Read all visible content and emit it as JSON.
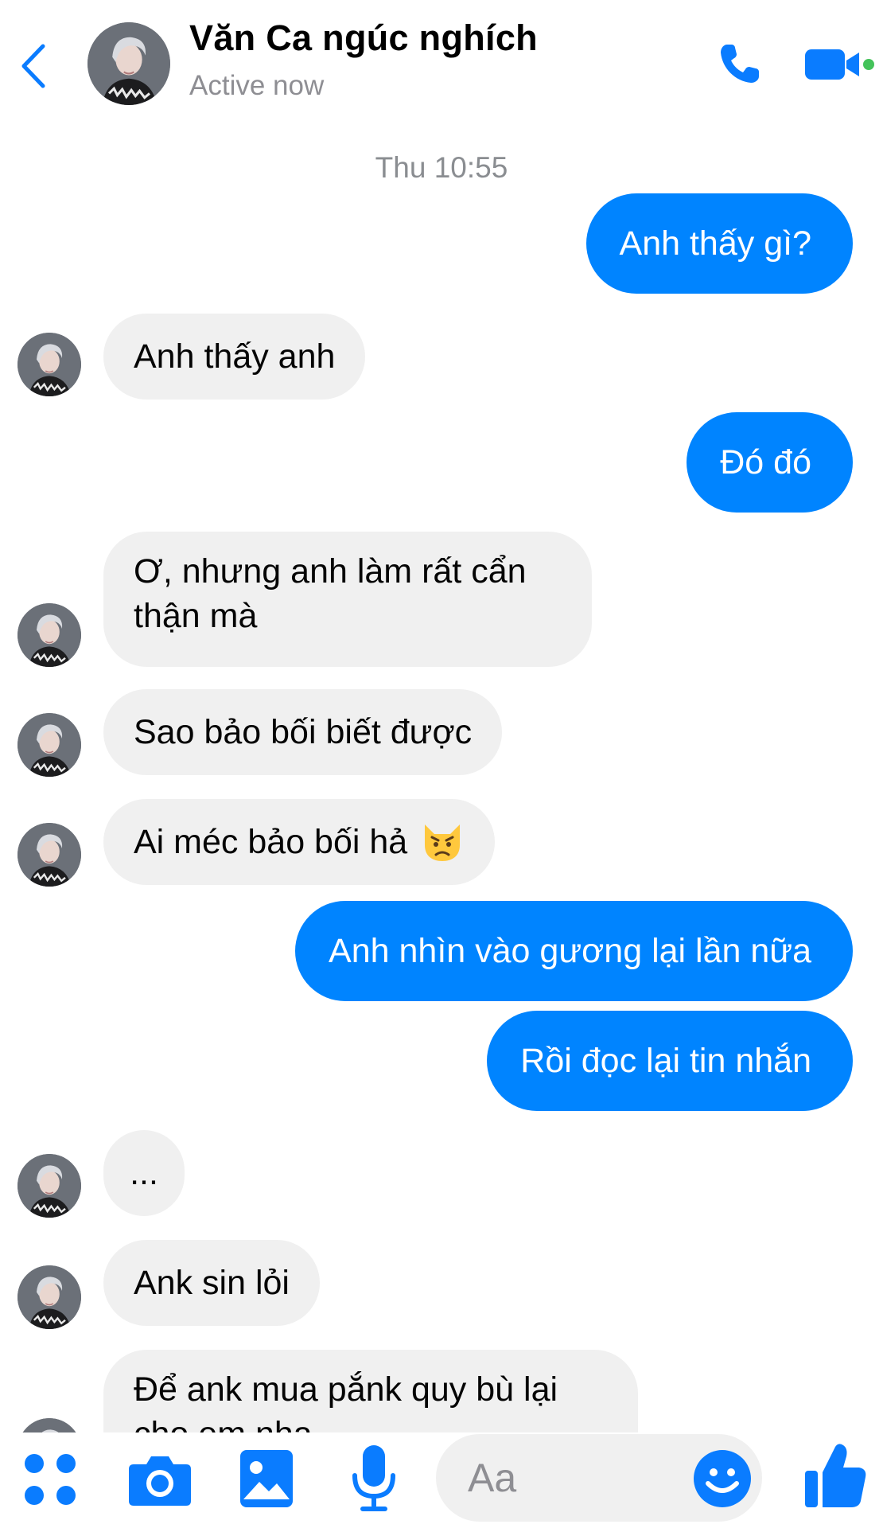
{
  "header": {
    "contact_name": "Văn Ca ngúc nghích",
    "status": "Active now"
  },
  "thread": {
    "timestamp": "Thu 10:55",
    "messages": [
      {
        "from": "me",
        "text": "Anh thấy gì?"
      },
      {
        "from": "contact",
        "text": "Anh thấy anh"
      },
      {
        "from": "me",
        "text": "Đó đó"
      },
      {
        "from": "contact",
        "text": "Ơ, nhưng anh làm rất cẩn thận mà"
      },
      {
        "from": "contact",
        "text": "Sao bảo bối biết được"
      },
      {
        "from": "contact",
        "text": "Ai méc bảo bối hả",
        "emoji": "pouting-cat-face"
      },
      {
        "from": "me",
        "text": "Anh nhìn vào gương lại lần nữa"
      },
      {
        "from": "me",
        "text": "Rồi đọc lại tin nhắn"
      },
      {
        "from": "contact",
        "text": "..."
      },
      {
        "from": "contact",
        "text": "Ank sin lỏi"
      },
      {
        "from": "contact",
        "text": "Để ank mua pắnk quy bù lại cho em nha"
      }
    ]
  },
  "composer": {
    "placeholder": "Aa"
  },
  "colors": {
    "accent": "#0084ff",
    "incoming_bubble": "#f0f0f0",
    "active_dot": "#44c35a"
  },
  "icons": [
    "back-chevron-icon",
    "phone-icon",
    "video-camera-icon",
    "apps-grid-icon",
    "camera-icon",
    "photo-icon",
    "microphone-icon",
    "emoji-icon",
    "thumbs-up-icon"
  ]
}
